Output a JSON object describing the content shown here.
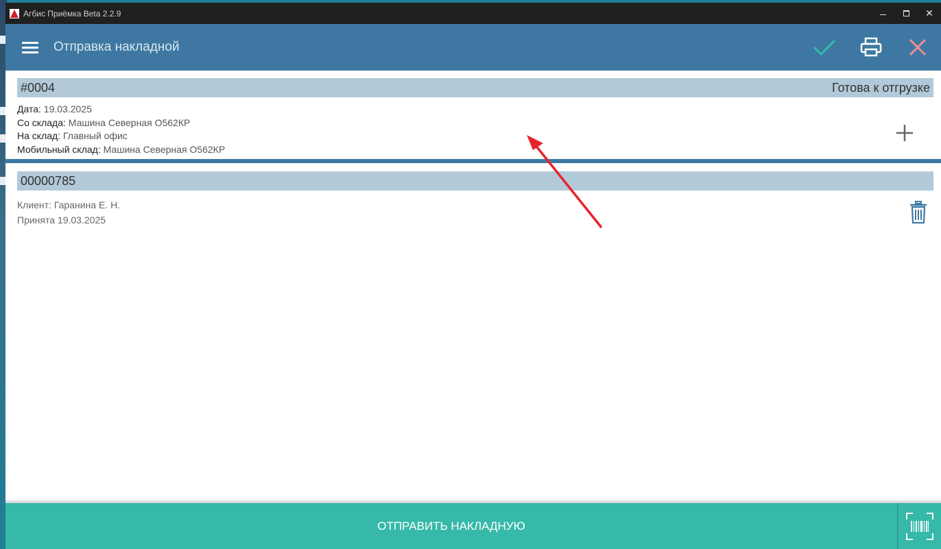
{
  "window": {
    "title": "Агбис Приёмка Beta 2.2.9",
    "close_glyph": "✕"
  },
  "appbar": {
    "title": "Отправка накладной",
    "icons": [
      "menu-icon",
      "checkmark-icon",
      "printer-icon",
      "close-icon"
    ],
    "accent": "#3e78a2"
  },
  "document": {
    "number": "#0004",
    "status": "Готова к отгрузке",
    "date_label": "Дата:",
    "date_value": "19.03.2025",
    "from_label": "Со склада:",
    "from_value": "Машина Северная О562КР",
    "to_label": "На склад:",
    "to_value": "Главный офис",
    "mobile_label": "Мобильный склад:",
    "mobile_value": "Машина Северная О562КР"
  },
  "items": [
    {
      "number": "00000785",
      "client": "Клиент: Гаранина Е. Н.",
      "accepted": "Принята 19.03.2025"
    }
  ],
  "bottom": {
    "send_label": "ОТПРАВИТЬ НАКЛАДНУЮ",
    "scan_icon": "barcode-scan-icon",
    "color": "#36b9a8"
  },
  "colors": {
    "header_band": "#b2c9d9",
    "check": "#36b9a8",
    "close": "#f28a96",
    "annotation_arrow": "#e8242a"
  }
}
